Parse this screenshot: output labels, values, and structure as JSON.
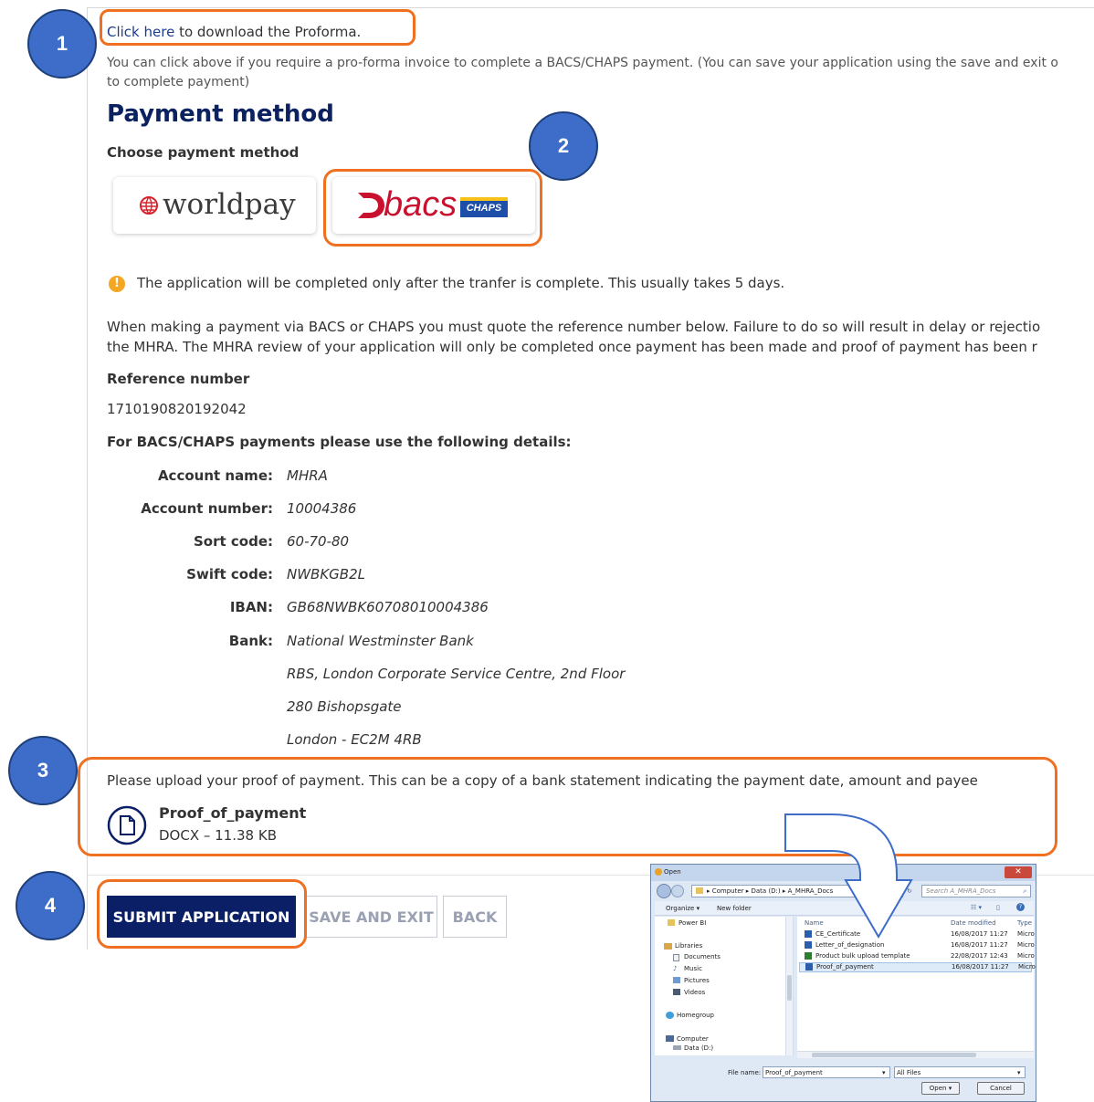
{
  "proforma": {
    "link_text": "Click here",
    "rest_text": " to download the Proforma.",
    "info_line1": "You can click above if you require a pro-forma invoice to complete a BACS/CHAPS payment. (You can save your application using the save and exit o",
    "info_line2": "to complete payment)"
  },
  "payment": {
    "heading": "Payment method",
    "choose_label": "Choose payment method",
    "worldpay_logo": "worldpay",
    "bacs_logo": "bacs",
    "chaps_logo": "CHAPS",
    "warning": "The application will be completed only after the tranfer is complete. This usually takes 5 days.",
    "notice_line1": "When making a payment via BACS or CHAPS you must quote the reference number below. Failure to do so will result in delay or rejectio",
    "notice_line2": "the MHRA. The MHRA review of your application will only be completed once payment has been made and proof of payment has been r",
    "reference_label": "Reference number",
    "reference_number": "1710190820192042",
    "details_heading": "For BACS/CHAPS payments please use the following details:",
    "details": [
      {
        "label": "Account name:",
        "value": "MHRA"
      },
      {
        "label": "Account number:",
        "value": "10004386"
      },
      {
        "label": "Sort code:",
        "value": "60-70-80"
      },
      {
        "label": "Swift code:",
        "value": "NWBKGB2L"
      },
      {
        "label": "IBAN:",
        "value": "GB68NWBK60708010004386"
      },
      {
        "label": "Bank:",
        "value": "National Westminster Bank"
      }
    ],
    "address_lines": [
      "RBS, London Corporate Service Centre, 2nd Floor",
      "280 Bishopsgate",
      "London - EC2M 4RB"
    ]
  },
  "upload": {
    "instruction": "Please upload your proof of payment. This can be a copy of a bank statement indicating the payment date, amount and payee",
    "file_name": "Proof_of_payment",
    "file_meta": "DOCX – 11.38 KB"
  },
  "buttons": {
    "submit": "SUBMIT APPLICATION",
    "save_exit": "SAVE AND EXIT",
    "back": "BACK"
  },
  "badges": [
    "1",
    "2",
    "3",
    "4"
  ],
  "dialog": {
    "title": "Open",
    "close": "✕",
    "breadcrumb": "▸ Computer ▸ Data (D:) ▸ A_MHRA_Docs",
    "search_placeholder": "Search A_MHRA_Docs",
    "organize": "Organize ▾",
    "new_folder": "New folder",
    "nav_items": [
      "Power BI",
      "Libraries",
      "Documents",
      "Music",
      "Pictures",
      "Videos",
      "Homegroup",
      "Computer",
      "Data (D:)"
    ],
    "columns": {
      "name": "Name",
      "date": "Date modified",
      "type": "Type"
    },
    "files": [
      {
        "name": "CE_Certificate",
        "date": "16/08/2017 11:27",
        "type": "Micro"
      },
      {
        "name": "Letter_of_designation",
        "date": "16/08/2017 11:27",
        "type": "Micro"
      },
      {
        "name": "Product bulk upload template",
        "date": "22/08/2017 12:43",
        "type": "Micro"
      },
      {
        "name": "Proof_of_payment",
        "date": "16/08/2017 11:27",
        "type": "Micro"
      }
    ],
    "file_name_label": "File name:",
    "file_name_value": "Proof_of_payment",
    "file_type": "All Files",
    "open": "Open",
    "cancel": "Cancel"
  },
  "colors": {
    "heading": "#0b2160",
    "link": "#1d3c8e",
    "highlight": "#f07021",
    "badge": "#3d6dc8",
    "primary_button": "#0b1f66",
    "warning_icon": "#f5a623"
  }
}
